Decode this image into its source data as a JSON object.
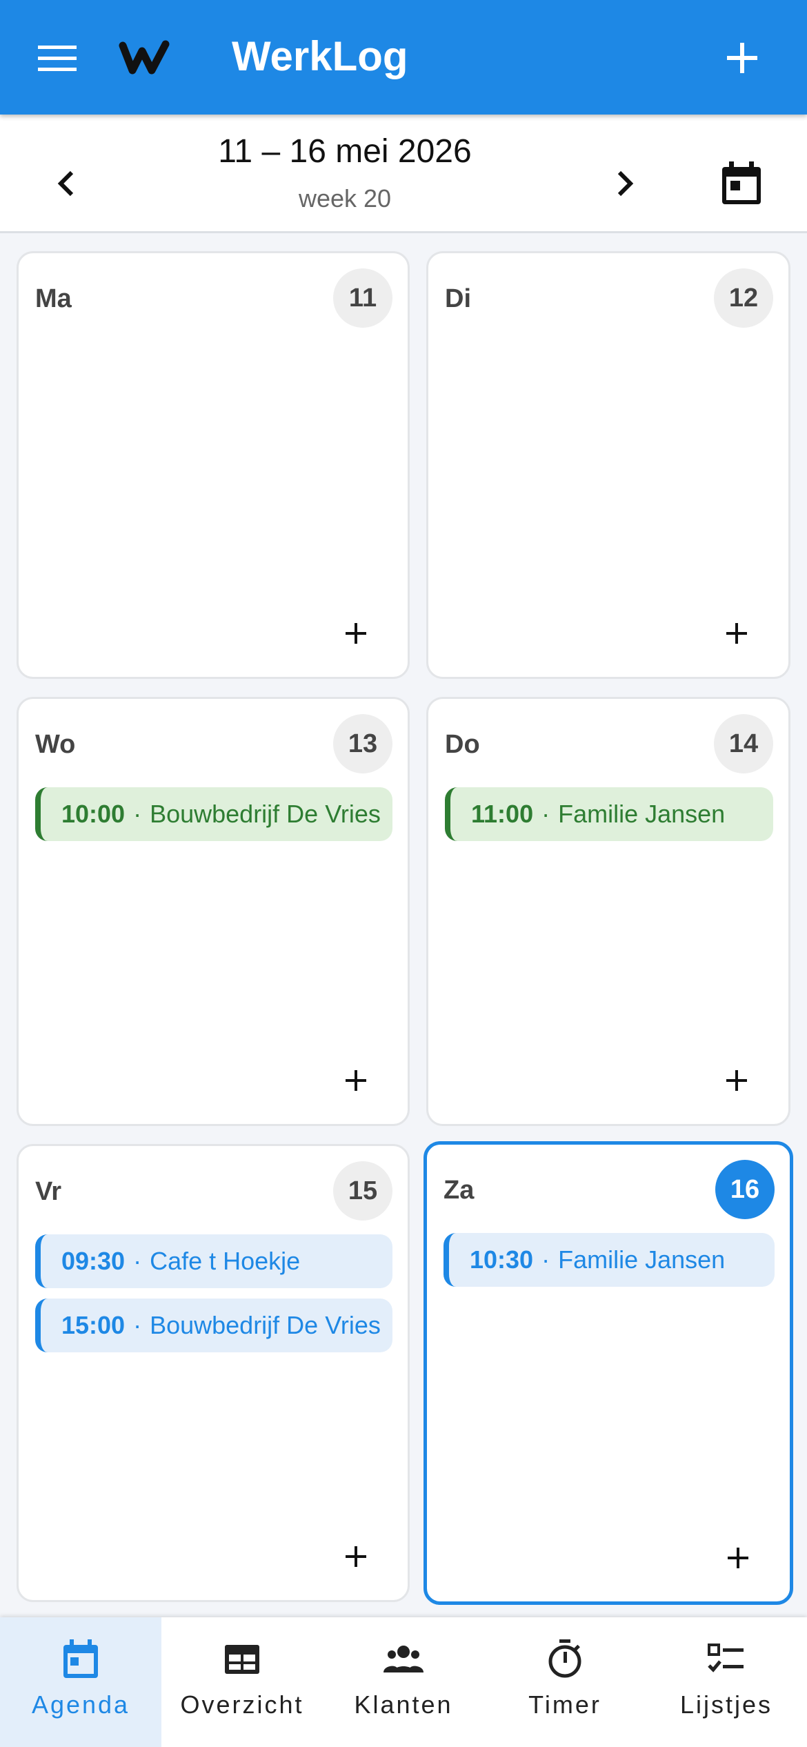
{
  "app": {
    "title": "WerkLog"
  },
  "week": {
    "range": "11 – 16 mei 2026",
    "label": "week 20"
  },
  "days": [
    {
      "name": "Ma",
      "num": "11",
      "today": false,
      "entries": []
    },
    {
      "name": "Di",
      "num": "12",
      "today": false,
      "entries": []
    },
    {
      "name": "Wo",
      "num": "13",
      "today": false,
      "entries": [
        {
          "time": "10:00",
          "sep": "·",
          "client": "Bouwbedrijf De Vries",
          "status": "green"
        }
      ]
    },
    {
      "name": "Do",
      "num": "14",
      "today": false,
      "entries": [
        {
          "time": "11:00",
          "sep": "·",
          "client": "Familie Jansen",
          "status": "green"
        }
      ]
    },
    {
      "name": "Vr",
      "num": "15",
      "today": false,
      "entries": [
        {
          "time": "09:30",
          "sep": "·",
          "client": "Cafe t Hoekje",
          "status": "blue"
        },
        {
          "time": "15:00",
          "sep": "·",
          "client": "Bouwbedrijf De Vries",
          "status": "blue"
        }
      ]
    },
    {
      "name": "Za",
      "num": "16",
      "today": true,
      "entries": [
        {
          "time": "10:30",
          "sep": "·",
          "client": "Familie Jansen",
          "status": "blue"
        }
      ]
    }
  ],
  "nav": {
    "items": [
      {
        "label": "Agenda",
        "icon": "calendar-icon",
        "active": true
      },
      {
        "label": "Overzicht",
        "icon": "table-icon",
        "active": false
      },
      {
        "label": "Klanten",
        "icon": "people-icon",
        "active": false
      },
      {
        "label": "Timer",
        "icon": "timer-icon",
        "active": false
      },
      {
        "label": "Lijstjes",
        "icon": "checklist-icon",
        "active": false
      }
    ]
  },
  "colors": {
    "primary": "#1e88e5",
    "done_bg": "#dff0db",
    "done_fg": "#2e7d32",
    "planned_bg": "#e3eefa"
  }
}
